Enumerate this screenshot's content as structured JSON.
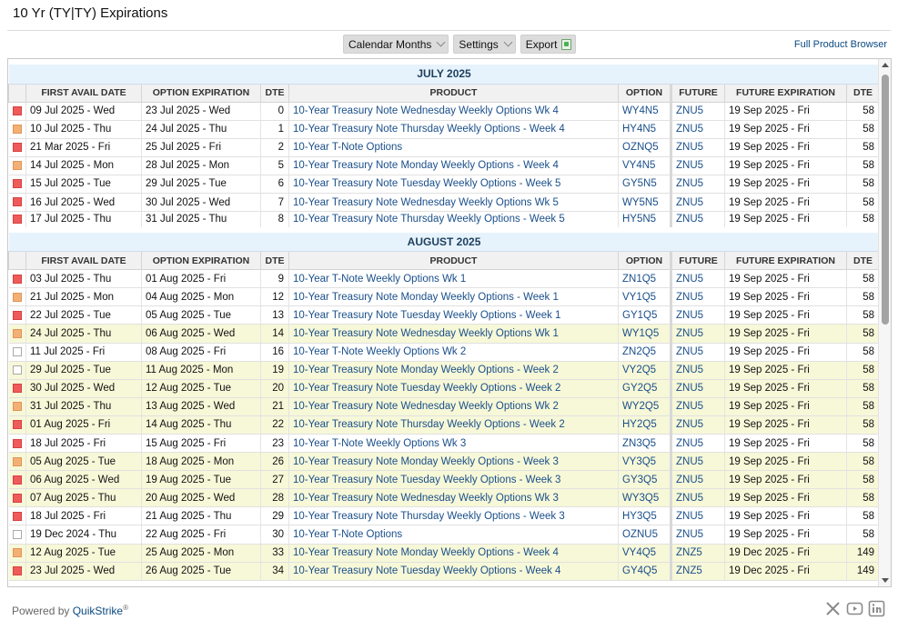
{
  "page": {
    "title": "10 Yr (TY|TY) Expirations"
  },
  "toolbar": {
    "calendar_label": "Calendar Months",
    "settings_label": "Settings",
    "export_label": "Export",
    "full_browser_link": "Full Product Browser"
  },
  "columns": {
    "first_avail": "FIRST AVAIL DATE",
    "option_exp": "OPTION EXPIRATION",
    "dte": "DTE",
    "product": "PRODUCT",
    "option": "OPTION",
    "future": "FUTURE",
    "future_exp": "FUTURE EXPIRATION",
    "future_dte": "DTE"
  },
  "colors": {
    "marker_red": "#ef5a5a",
    "marker_orange": "#f3b074",
    "highlight_row": "#f7f8d8",
    "link": "#1a4f8a",
    "month_band": "#e7f3fc"
  },
  "months": [
    {
      "name": "JULY 2025",
      "rows": [
        {
          "marker": "red",
          "first": "09 Jul 2025 - Wed",
          "exp": "23 Jul 2025 - Wed",
          "dte": "0",
          "product": "10-Year Treasury Note Wednesday Weekly Options Wk 4",
          "option": "WY4N5",
          "future": "ZNU5",
          "fexp": "19 Sep 2025 - Fri",
          "fdte": "58",
          "hl": false
        },
        {
          "marker": "orange",
          "first": "10 Jul 2025 - Thu",
          "exp": "24 Jul 2025 - Thu",
          "dte": "1",
          "product": "10-Year Treasury Note Thursday Weekly Options - Week 4",
          "option": "HY4N5",
          "future": "ZNU5",
          "fexp": "19 Sep 2025 - Fri",
          "fdte": "58",
          "hl": false
        },
        {
          "marker": "red",
          "first": "21 Mar 2025 - Fri",
          "exp": "25 Jul 2025 - Fri",
          "dte": "2",
          "product": "10-Year T-Note Options",
          "option": "OZNQ5",
          "future": "ZNU5",
          "fexp": "19 Sep 2025 - Fri",
          "fdte": "58",
          "hl": false
        },
        {
          "marker": "orange",
          "first": "14 Jul 2025 - Mon",
          "exp": "28 Jul 2025 - Mon",
          "dte": "5",
          "product": "10-Year Treasury Note Monday Weekly Options - Week 4",
          "option": "VY4N5",
          "future": "ZNU5",
          "fexp": "19 Sep 2025 - Fri",
          "fdte": "58",
          "hl": false
        },
        {
          "marker": "red",
          "first": "15 Jul 2025 - Tue",
          "exp": "29 Jul 2025 - Tue",
          "dte": "6",
          "product": "10-Year Treasury Note Tuesday Weekly Options - Week 5",
          "option": "GY5N5",
          "future": "ZNU5",
          "fexp": "19 Sep 2025 - Fri",
          "fdte": "58",
          "hl": false
        },
        {
          "marker": "red",
          "first": "16 Jul 2025 - Wed",
          "exp": "30 Jul 2025 - Wed",
          "dte": "7",
          "product": "10-Year Treasury Note Wednesday Weekly Options Wk 5",
          "option": "WY5N5",
          "future": "ZNU5",
          "fexp": "19 Sep 2025 - Fri",
          "fdte": "58",
          "hl": false
        },
        {
          "marker": "red",
          "first": "17 Jul 2025 - Thu",
          "exp": "31 Jul 2025 - Thu",
          "dte": "8",
          "product": "10-Year Treasury Note Thursday Weekly Options - Week 5",
          "option": "HY5N5",
          "future": "ZNU5",
          "fexp": "19 Sep 2025 - Fri",
          "fdte": "58",
          "hl": false
        }
      ]
    },
    {
      "name": "AUGUST 2025",
      "rows": [
        {
          "marker": "red",
          "first": "03 Jul 2025 - Thu",
          "exp": "01 Aug 2025 - Fri",
          "dte": "9",
          "product": "10-Year T-Note Weekly Options Wk 1",
          "option": "ZN1Q5",
          "future": "ZNU5",
          "fexp": "19 Sep 2025 - Fri",
          "fdte": "58",
          "hl": false
        },
        {
          "marker": "orange",
          "first": "21 Jul 2025 - Mon",
          "exp": "04 Aug 2025 - Mon",
          "dte": "12",
          "product": "10-Year Treasury Note Monday Weekly Options - Week 1",
          "option": "VY1Q5",
          "future": "ZNU5",
          "fexp": "19 Sep 2025 - Fri",
          "fdte": "58",
          "hl": false
        },
        {
          "marker": "red",
          "first": "22 Jul 2025 - Tue",
          "exp": "05 Aug 2025 - Tue",
          "dte": "13",
          "product": "10-Year Treasury Note Tuesday Weekly Options - Week 1",
          "option": "GY1Q5",
          "future": "ZNU5",
          "fexp": "19 Sep 2025 - Fri",
          "fdte": "58",
          "hl": false
        },
        {
          "marker": "orange",
          "first": "24 Jul 2025 - Thu",
          "exp": "06 Aug 2025 - Wed",
          "dte": "14",
          "product": "10-Year Treasury Note Wednesday Weekly Options Wk 1",
          "option": "WY1Q5",
          "future": "ZNU5",
          "fexp": "19 Sep 2025 - Fri",
          "fdte": "58",
          "hl": true
        },
        {
          "marker": "empty",
          "first": "11 Jul 2025 - Fri",
          "exp": "08 Aug 2025 - Fri",
          "dte": "16",
          "product": "10-Year T-Note Weekly Options Wk 2",
          "option": "ZN2Q5",
          "future": "ZNU5",
          "fexp": "19 Sep 2025 - Fri",
          "fdte": "58",
          "hl": false
        },
        {
          "marker": "empty",
          "first": "29 Jul 2025 - Tue",
          "exp": "11 Aug 2025 - Mon",
          "dte": "19",
          "product": "10-Year Treasury Note Monday Weekly Options - Week 2",
          "option": "VY2Q5",
          "future": "ZNU5",
          "fexp": "19 Sep 2025 - Fri",
          "fdte": "58",
          "hl": true
        },
        {
          "marker": "red",
          "first": "30 Jul 2025 - Wed",
          "exp": "12 Aug 2025 - Tue",
          "dte": "20",
          "product": "10-Year Treasury Note Tuesday Weekly Options - Week 2",
          "option": "GY2Q5",
          "future": "ZNU5",
          "fexp": "19 Sep 2025 - Fri",
          "fdte": "58",
          "hl": true
        },
        {
          "marker": "orange",
          "first": "31 Jul 2025 - Thu",
          "exp": "13 Aug 2025 - Wed",
          "dte": "21",
          "product": "10-Year Treasury Note Wednesday Weekly Options Wk 2",
          "option": "WY2Q5",
          "future": "ZNU5",
          "fexp": "19 Sep 2025 - Fri",
          "fdte": "58",
          "hl": true
        },
        {
          "marker": "red",
          "first": "01 Aug 2025 - Fri",
          "exp": "14 Aug 2025 - Thu",
          "dte": "22",
          "product": "10-Year Treasury Note Thursday Weekly Options - Week 2",
          "option": "HY2Q5",
          "future": "ZNU5",
          "fexp": "19 Sep 2025 - Fri",
          "fdte": "58",
          "hl": true
        },
        {
          "marker": "red",
          "first": "18 Jul 2025 - Fri",
          "exp": "15 Aug 2025 - Fri",
          "dte": "23",
          "product": "10-Year T-Note Weekly Options Wk 3",
          "option": "ZN3Q5",
          "future": "ZNU5",
          "fexp": "19 Sep 2025 - Fri",
          "fdte": "58",
          "hl": false
        },
        {
          "marker": "orange",
          "first": "05 Aug 2025 - Tue",
          "exp": "18 Aug 2025 - Mon",
          "dte": "26",
          "product": "10-Year Treasury Note Monday Weekly Options - Week 3",
          "option": "VY3Q5",
          "future": "ZNU5",
          "fexp": "19 Sep 2025 - Fri",
          "fdte": "58",
          "hl": true
        },
        {
          "marker": "red",
          "first": "06 Aug 2025 - Wed",
          "exp": "19 Aug 2025 - Tue",
          "dte": "27",
          "product": "10-Year Treasury Note Tuesday Weekly Options - Week 3",
          "option": "GY3Q5",
          "future": "ZNU5",
          "fexp": "19 Sep 2025 - Fri",
          "fdte": "58",
          "hl": true
        },
        {
          "marker": "red",
          "first": "07 Aug 2025 - Thu",
          "exp": "20 Aug 2025 - Wed",
          "dte": "28",
          "product": "10-Year Treasury Note Wednesday Weekly Options Wk 3",
          "option": "WY3Q5",
          "future": "ZNU5",
          "fexp": "19 Sep 2025 - Fri",
          "fdte": "58",
          "hl": true
        },
        {
          "marker": "red",
          "first": "18 Jul 2025 - Fri",
          "exp": "21 Aug 2025 - Thu",
          "dte": "29",
          "product": "10-Year Treasury Note Thursday Weekly Options - Week 3",
          "option": "HY3Q5",
          "future": "ZNU5",
          "fexp": "19 Sep 2025 - Fri",
          "fdte": "58",
          "hl": false
        },
        {
          "marker": "empty",
          "first": "19 Dec 2024 - Thu",
          "exp": "22 Aug 2025 - Fri",
          "dte": "30",
          "product": "10-Year T-Note Options",
          "option": "OZNU5",
          "future": "ZNU5",
          "fexp": "19 Sep 2025 - Fri",
          "fdte": "58",
          "hl": false
        },
        {
          "marker": "orange",
          "first": "12 Aug 2025 - Tue",
          "exp": "25 Aug 2025 - Mon",
          "dte": "33",
          "product": "10-Year Treasury Note Monday Weekly Options - Week 4",
          "option": "VY4Q5",
          "future": "ZNZ5",
          "fexp": "19 Dec 2025 - Fri",
          "fdte": "149",
          "hl": true
        },
        {
          "marker": "red",
          "first": "23 Jul 2025 - Wed",
          "exp": "26 Aug 2025 - Tue",
          "dte": "34",
          "product": "10-Year Treasury Note Tuesday Weekly Options - Week 4",
          "option": "GY4Q5",
          "future": "ZNZ5",
          "fexp": "19 Dec 2025 - Fri",
          "fdte": "149",
          "hl": true
        }
      ]
    }
  ],
  "footer": {
    "powered_text": "Powered by",
    "brand": "QuikStrike",
    "brand_mark": "®",
    "social_icons": [
      "x-icon",
      "youtube-icon",
      "linkedin-icon"
    ]
  }
}
